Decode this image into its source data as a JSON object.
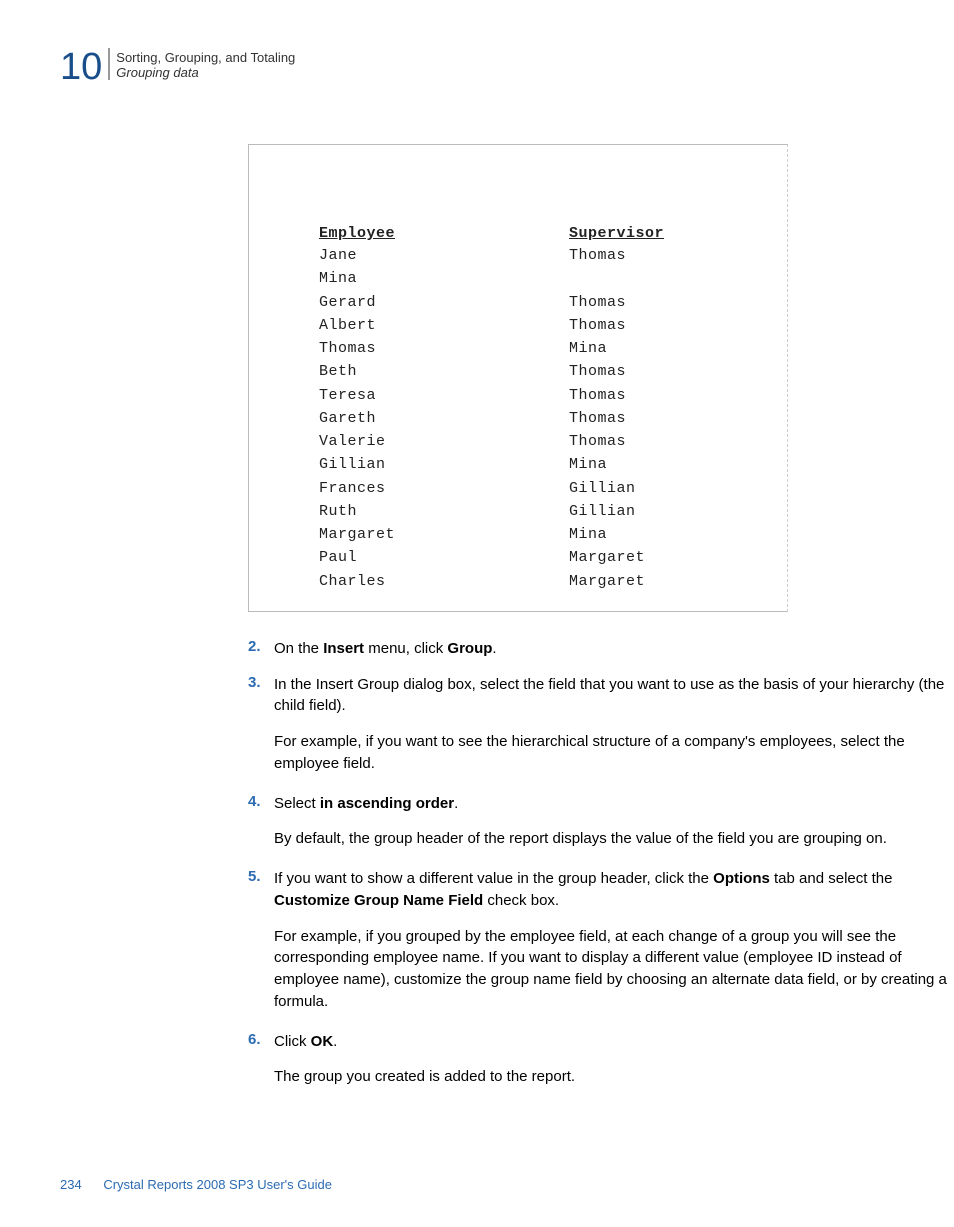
{
  "header": {
    "chapter_number": "10",
    "title": "Sorting, Grouping, and Totaling",
    "subtitle": "Grouping data"
  },
  "report": {
    "left_header": "Employee",
    "right_header": "Supervisor",
    "left_items": [
      "Jane",
      "Mina",
      "Gerard",
      "Albert",
      "Thomas",
      "Beth",
      "Teresa",
      "Gareth",
      "Valerie",
      "Gillian",
      "Frances",
      "Ruth",
      "Margaret",
      "Paul",
      "Charles"
    ],
    "right_items": [
      "Thomas",
      "",
      "Thomas",
      "Thomas",
      "Mina",
      "Thomas",
      "Thomas",
      "Thomas",
      "Thomas",
      "Mina",
      "Gillian",
      "Gillian",
      "Mina",
      "Margaret",
      "Margaret"
    ]
  },
  "steps": {
    "s2": {
      "num": "2.",
      "pre": "On the ",
      "b1": "Insert",
      "mid": " menu, click ",
      "b2": "Group",
      "post": "."
    },
    "s3": {
      "num": "3.",
      "text": "In the Insert Group dialog box, select the field that you want to use as the basis of your hierarchy (the child field).",
      "para": "For example, if you want to see the hierarchical structure of a company's employees, select the employee field."
    },
    "s4": {
      "num": "4.",
      "pre": "Select ",
      "b1": "in ascending order",
      "post": ".",
      "para": "By default, the group header of the report displays the value of the field you are grouping on."
    },
    "s5": {
      "num": "5.",
      "pre": "If you want to show a different value in the group header, click the ",
      "b1": "Options",
      "mid": " tab and select the ",
      "b2": "Customize Group Name Field",
      "post": " check box.",
      "para": "For example, if you grouped by the employee field, at each change of a group you will see the corresponding employee name. If you want to display a different value (employee ID instead of employee name), customize the group name field by choosing an alternate data field, or by creating a formula."
    },
    "s6": {
      "num": "6.",
      "pre": "Click ",
      "b1": "OK",
      "post": ".",
      "para": "The group you created is added to the report."
    }
  },
  "footer": {
    "page": "234",
    "guide": "Crystal Reports 2008 SP3 User's Guide"
  }
}
